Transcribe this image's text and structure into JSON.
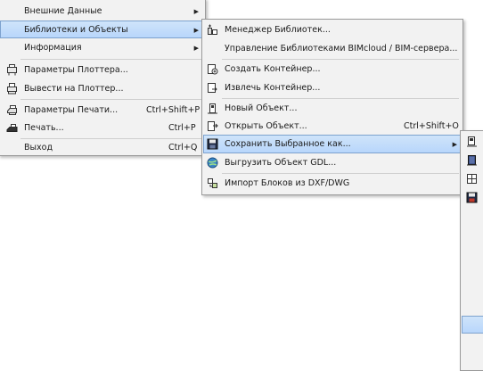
{
  "menu_file": {
    "items": [
      {
        "label": "Внешние Данные"
      },
      {
        "label": "Библиотеки и Объекты"
      },
      {
        "label": "Информация"
      },
      {
        "label": "Параметры Плоттера..."
      },
      {
        "label": "Вывести на Плоттер..."
      },
      {
        "label": "Параметры Печати...",
        "shortcut": "Ctrl+Shift+P"
      },
      {
        "label": "Печать...",
        "shortcut": "Ctrl+P"
      },
      {
        "label": "Выход",
        "shortcut": "Ctrl+Q"
      }
    ]
  },
  "menu_library": {
    "items": [
      {
        "label": "Менеджер Библиотек..."
      },
      {
        "label": "Управление Библиотеками BIMcloud / BIM-сервера..."
      },
      {
        "label": "Создать Контейнер..."
      },
      {
        "label": "Извлечь Контейнер..."
      },
      {
        "label": "Новый Объект..."
      },
      {
        "label": "Открыть Объект...",
        "shortcut": "Ctrl+Shift+O"
      },
      {
        "label": "Сохранить Выбранное как..."
      },
      {
        "label": "Выгрузить Объект GDL..."
      },
      {
        "label": "Импорт Блоков из DXF/DWG"
      }
    ]
  },
  "submenu_save": {
    "icons": [
      "object-icon",
      "door-icon",
      "window-icon",
      "save-disk-icon"
    ]
  },
  "colors": {
    "highlight_top": "#cfe4fa",
    "highlight_bottom": "#b8d6fb",
    "highlight_border": "#7da2ce",
    "menu_bg": "#f2f2f2",
    "separator": "#cfcfcf"
  }
}
